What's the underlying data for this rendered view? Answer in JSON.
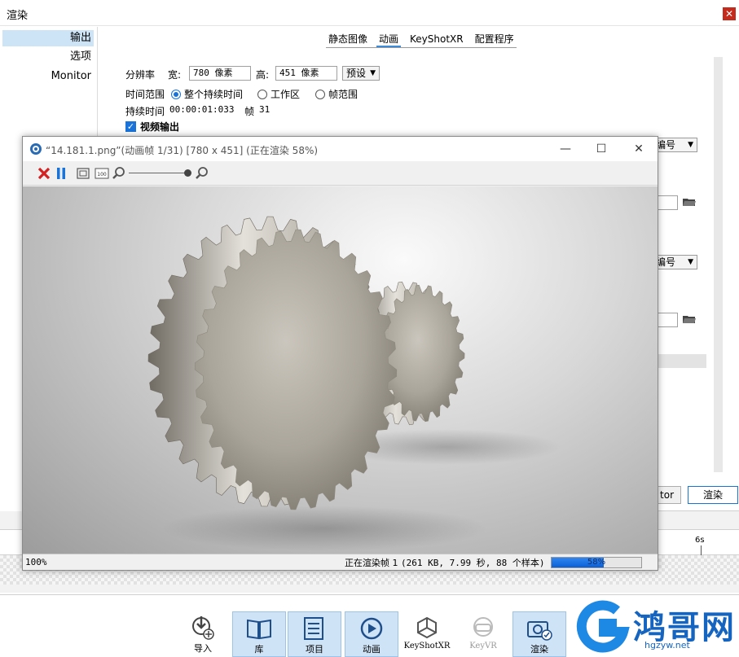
{
  "render_window": {
    "title": "渲染",
    "close_glyph": "✕",
    "sidebar": [
      {
        "label": "输出",
        "active": true
      },
      {
        "label": "选项",
        "active": false
      },
      {
        "label": "Monitor",
        "active": false
      }
    ],
    "tabs": [
      {
        "label": "静态图像",
        "active": false
      },
      {
        "label": "动画",
        "active": true
      },
      {
        "label": "KeyShotXR",
        "active": false
      },
      {
        "label": "配置程序",
        "active": false
      }
    ],
    "resolution": {
      "label": "分辨率",
      "width_label": "宽:",
      "width_value": "780 像素",
      "height_label": "高:",
      "height_value": "451 像素",
      "preset_label": "预设"
    },
    "time_range": {
      "label": "时间范围",
      "options": [
        "整个持续时间",
        "工作区",
        "帧范围"
      ],
      "selected": "整个持续时间"
    },
    "duration": {
      "label": "持续时间",
      "value": "00:00:01:033",
      "frame_label": "帧",
      "frame_value": "31"
    },
    "video_output": {
      "label": "视频输出",
      "checked": true
    },
    "numbering_select_1": "编号",
    "numbering_select_2": "编号",
    "buttons": {
      "monitor_partial": "tor",
      "render": "渲染"
    }
  },
  "timeline": {
    "tick_label": "6s"
  },
  "preview": {
    "title": "“14.181.1.png”(动画帧 1/31)  [780 x 451] (正在渲染 58%)",
    "window_controls": {
      "minimize": "—",
      "maximize": "☐",
      "close": "✕"
    },
    "toolbar_icons": [
      "stop-icon",
      "pause-icon",
      "fit-icon",
      "actual-size-icon",
      "zoom-out-icon",
      "zoom-slider",
      "zoom-in-icon"
    ],
    "actual_size_label": "100",
    "zoom_level": "100%",
    "status_prefix": "正在渲染帧 1",
    "status_detail": "(261 KB, 7.99 秒, 88 个样本)",
    "progress_percent": 58,
    "progress_label": "58%"
  },
  "bottom_toolbar": [
    {
      "label": "导入",
      "icon": "import-icon",
      "highlighted": false
    },
    {
      "label": "库",
      "icon": "library-book-icon",
      "highlighted": true
    },
    {
      "label": "项目",
      "icon": "project-list-icon",
      "highlighted": true
    },
    {
      "label": "动画",
      "icon": "animation-play-icon",
      "highlighted": true
    },
    {
      "label": "KeyShotXR",
      "icon": "keyshotxr-cube-icon",
      "highlighted": false
    },
    {
      "label": "KeyVR",
      "icon": "keyvr-headset-icon",
      "highlighted": false
    },
    {
      "label": "渲染",
      "icon": "render-camera-icon",
      "highlighted": true
    }
  ],
  "watermark": {
    "text": "鸿哥网",
    "url": "hgzyw.net"
  },
  "colors": {
    "accent": "#1a73d9",
    "highlight": "#cfe3f7",
    "progress": "#0b5fd6",
    "brand": "#1565c0"
  }
}
